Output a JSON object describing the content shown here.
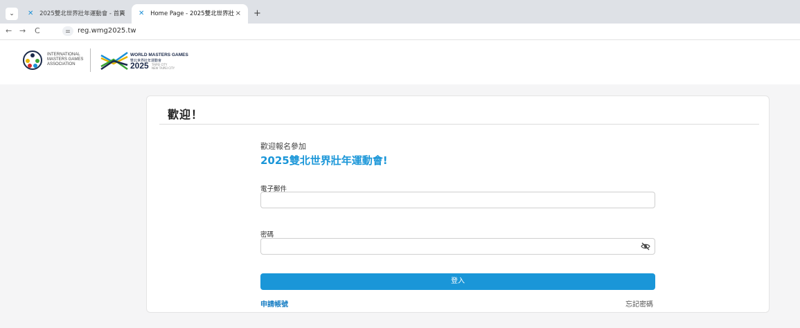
{
  "browser": {
    "tabs": [
      {
        "title": "2025雙北世界壯年運動會 - 首頁",
        "close": "×"
      },
      {
        "title": "Home Page - 2025雙北世界壯",
        "close": "×"
      }
    ],
    "menu_glyph": "⌄",
    "new_tab": "+",
    "back": "←",
    "forward": "→",
    "reload": "C",
    "site_info": "⚌",
    "url": "reg.wmg2025.tw"
  },
  "header": {
    "imga": {
      "line1": "INTERNATIONAL",
      "line2": "MASTERS GAMES",
      "line3": "ASSOCIATION"
    },
    "wmg": {
      "title": "WORLD MASTERS GAMES",
      "sub": "雙北世界壯年運動會",
      "year": "2025",
      "city1": "TAIPEI CITY",
      "city2": "NEW TAIPEI CITY"
    }
  },
  "card": {
    "title": "歡迎！",
    "welcome": "歡迎報名參加",
    "event": "2025雙北世界壯年運動會!",
    "email_label": "電子郵件",
    "email_value": "",
    "password_label": "密碼",
    "password_value": "",
    "login_label": "登入",
    "register_link": "申請帳號",
    "forgot_link": "忘記密碼"
  },
  "colors": {
    "accent": "#1a96d8",
    "link": "#1a7fc4",
    "brand_navy": "#1b2a4a"
  },
  "icons": {
    "password_toggle": "eye-slash-icon",
    "imga_logo": "imga-logo-icon",
    "wmg_logo": "wmg-logo-icon"
  }
}
